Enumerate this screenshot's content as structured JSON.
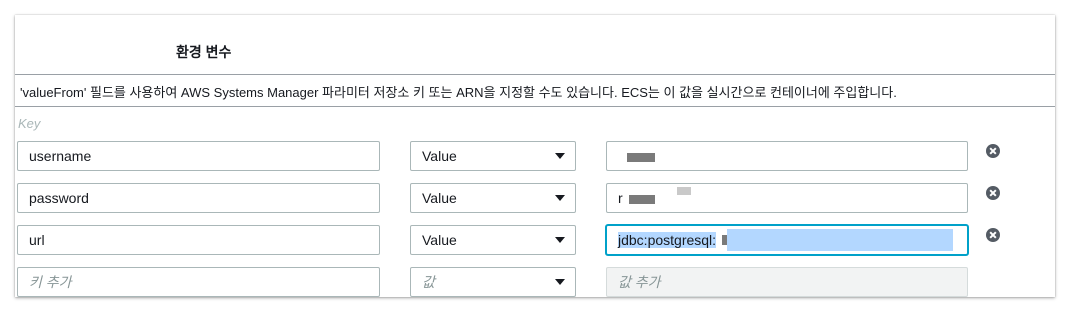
{
  "section": {
    "title": "환경 변수",
    "description": "'valueFrom' 필드를 사용하여 AWS Systems Manager 파라미터 저장소 키 또는 ARN을 지정할 수도 있습니다. ECS는 이 값을 실시간으로 컨테이너에 주입합니다."
  },
  "columns": {
    "key_header": "Key"
  },
  "rows": [
    {
      "key": "username",
      "type": "Value",
      "value": ""
    },
    {
      "key": "password",
      "type": "Value",
      "value": "r"
    },
    {
      "key": "url",
      "type": "Value",
      "value": "jdbc:postgresql:"
    }
  ],
  "new_row": {
    "key_placeholder": "키 추가",
    "type_placeholder": "값",
    "value_placeholder": "값 추가"
  },
  "icons": {
    "remove": "close-circle-icon",
    "dropdown": "caret-down-icon"
  },
  "colors": {
    "focus": "#00a1c9",
    "selection": "#b3d7ff"
  }
}
